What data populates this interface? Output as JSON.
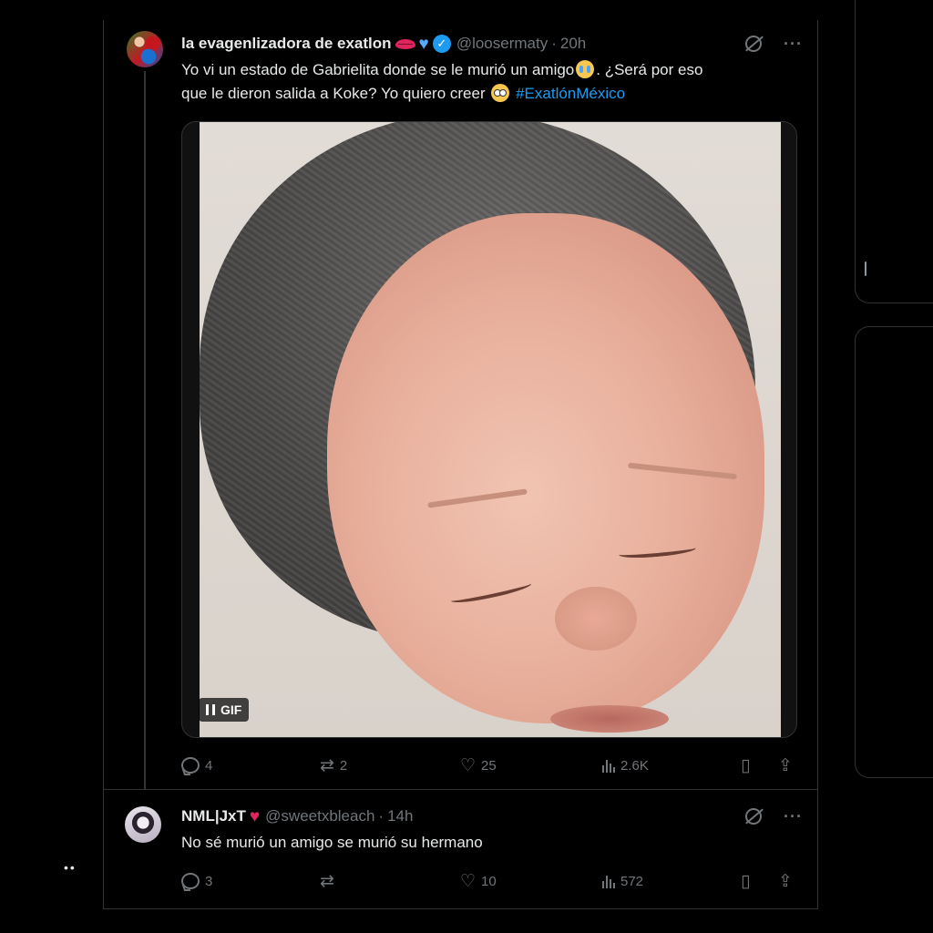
{
  "tweet": {
    "author_name": "la evagenlizadora de exatlon",
    "handle": "@loosermaty",
    "time": "20h",
    "text_line1_a": "Yo vi un estado de Gabrielita donde se le murió un amigo",
    "text_line1_b": ". ¿Será por eso",
    "text_line2_a": "que le dieron salida a Koke? Yo quiero creer",
    "hashtag": "#ExatlónMéxico",
    "media_badge": "GIF",
    "stats": {
      "replies": "4",
      "reposts": "2",
      "likes": "25",
      "views": "2.6K"
    }
  },
  "reply": {
    "author_name": "NML|JxT",
    "handle": "@sweetxbleach",
    "time": "14h",
    "text": "No sé murió un amigo se murió su hermano",
    "stats": {
      "replies": "3",
      "reposts": "",
      "likes": "10",
      "views": "572"
    }
  },
  "misc": {
    "left_dots": "••",
    "separator": "·"
  },
  "icons": [
    "grok-icon",
    "more-icon",
    "reply-icon",
    "repost-icon",
    "like-icon",
    "views-icon",
    "bookmark-icon",
    "share-icon",
    "pause-icon",
    "verified-badge-icon"
  ],
  "colors": {
    "background": "#000000",
    "text": "#e7e9ea",
    "muted": "#71767b",
    "accent": "#1d9bf0",
    "border": "#2f3336"
  }
}
